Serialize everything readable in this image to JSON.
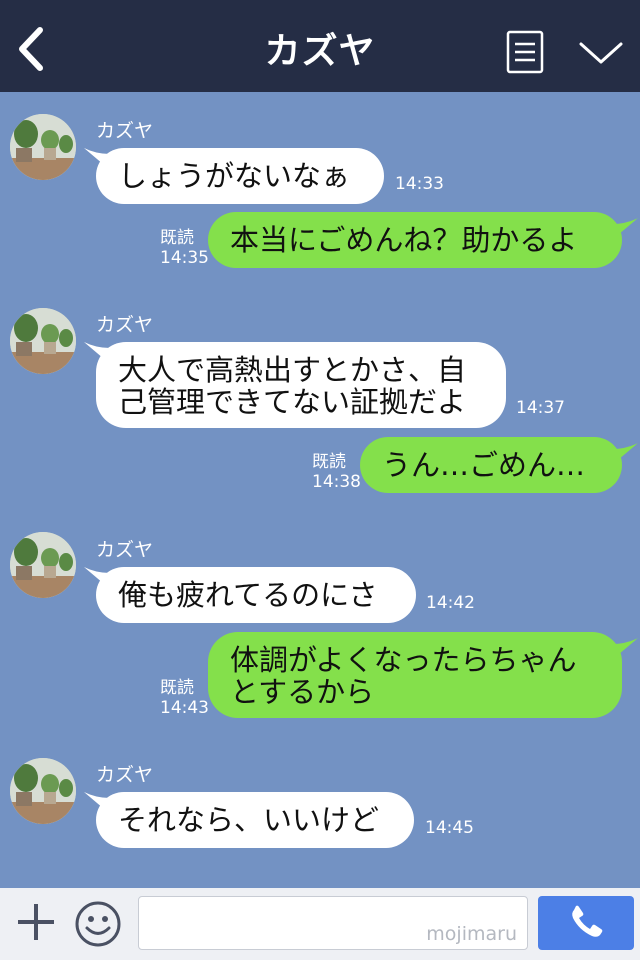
{
  "header": {
    "title": "カズヤ",
    "back_icon": "chevron-left-icon",
    "menu_icon": "menu-lines-icon",
    "collapse_icon": "chevron-down-icon"
  },
  "messages": [
    {
      "side": "left",
      "sender": "カズヤ",
      "text": "しょうがないなぁ",
      "time": "14:33"
    },
    {
      "side": "right",
      "read": "既読",
      "text": "本当にごめんね？助かるよ",
      "time": "14:35"
    },
    {
      "side": "left",
      "sender": "カズヤ",
      "lines": [
        "大人で高熱出すとかさ、自",
        "己管理できてない証拠だよ"
      ],
      "time": "14:37"
    },
    {
      "side": "right",
      "read": "既読",
      "text": "うん…ごめん…",
      "time": "14:38"
    },
    {
      "side": "left",
      "sender": "カズヤ",
      "text": "俺も疲れてるのにさ",
      "time": "14:42"
    },
    {
      "side": "right",
      "read": "既読",
      "lines": [
        "体調がよくなったらちゃん",
        "とするから"
      ],
      "time": "14:43"
    },
    {
      "side": "left",
      "sender": "カズヤ",
      "text": "それなら、いいけど",
      "time": "14:45"
    }
  ],
  "footer": {
    "plus_icon": "plus-icon",
    "emoji_icon": "smile-icon",
    "input_value": "",
    "watermark": "mojimaru",
    "call_icon": "phone-icon"
  },
  "colors": {
    "background": "#7392c3",
    "header": "#252d45",
    "bubble_left": "#ffffff",
    "bubble_right": "#84e04b",
    "call_button": "#4c7fe6"
  }
}
